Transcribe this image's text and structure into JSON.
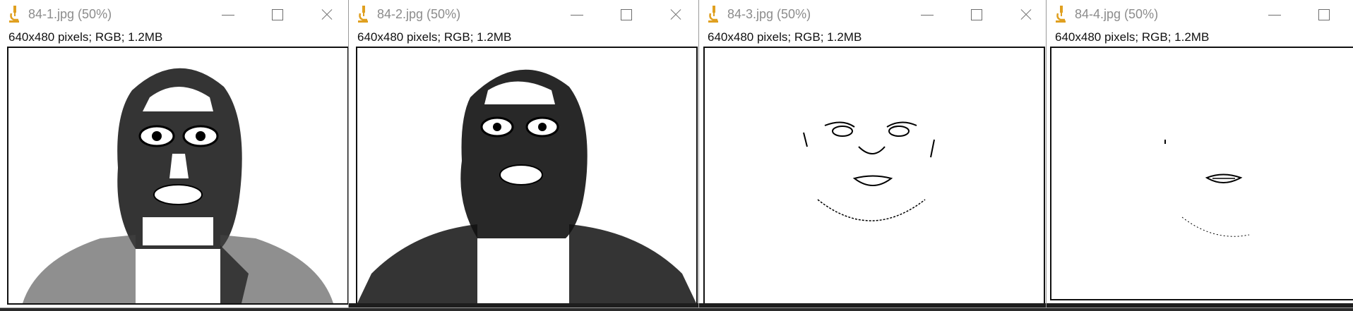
{
  "windows": [
    {
      "title": "84-1.jpg (50%)",
      "info": "640x480 pixels; RGB; 1.2MB",
      "image": "threshold-face-dense"
    },
    {
      "title": "84-2.jpg (50%)",
      "info": "640x480 pixels; RGB; 1.2MB",
      "image": "threshold-face-darker"
    },
    {
      "title": "84-3.jpg (50%)",
      "info": "640x480 pixels; RGB; 1.2MB",
      "image": "edge-face-outline"
    },
    {
      "title": "84-4.jpg (50%)",
      "info": "640x480 pixels; RGB; 1.2MB",
      "image": "edge-face-mouth"
    }
  ],
  "icons": {
    "app": "microscope-icon",
    "minimize": "minimize-icon",
    "maximize": "maximize-icon",
    "close": "close-icon"
  },
  "colors": {
    "title_text": "#8c8c8c",
    "app_icon": "#e0a020",
    "desktop": "#2b2b2b"
  }
}
